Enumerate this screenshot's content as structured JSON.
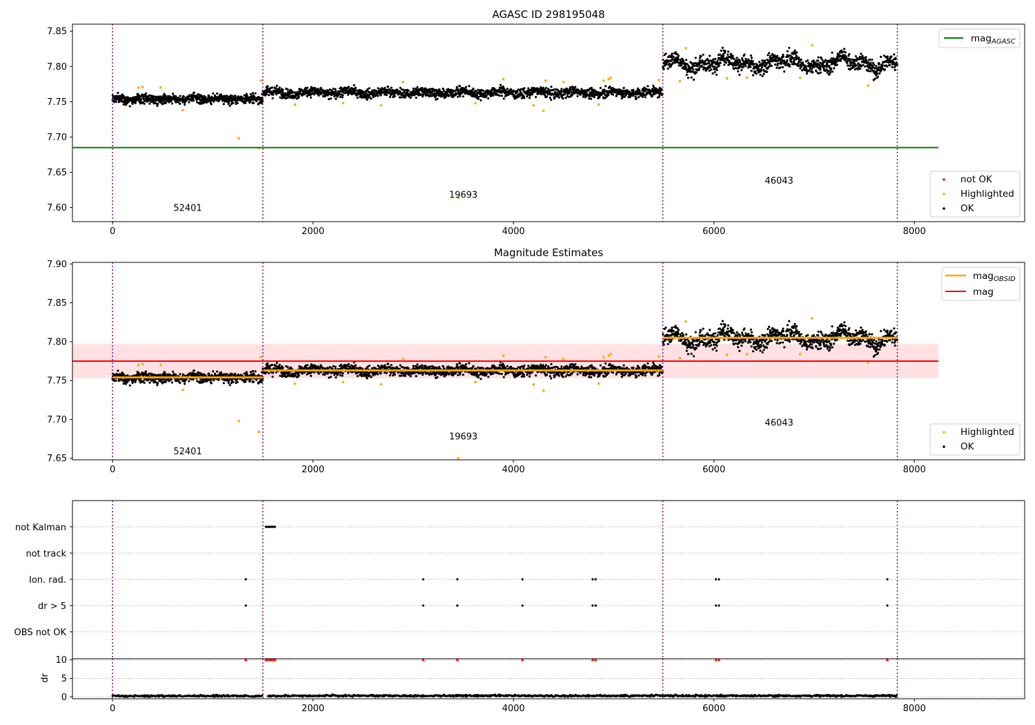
{
  "chart_data": [
    {
      "id": "panel1",
      "type": "scatter",
      "title": "AGASC ID 298195048",
      "xlim": [
        -400,
        9100
      ],
      "ylim": [
        7.58,
        7.86
      ],
      "xticks": [
        0,
        2000,
        4000,
        6000,
        8000
      ],
      "yticks": [
        7.6,
        7.65,
        7.7,
        7.75,
        7.8,
        7.85
      ],
      "ytick_labels": [
        "7.60",
        "7.65",
        "7.70",
        "7.75",
        "7.80",
        "7.85"
      ],
      "obs_boundaries": [
        0,
        1500,
        5490,
        7830
      ],
      "obs_labels": [
        {
          "text": "52401",
          "x": 750,
          "y": 7.595
        },
        {
          "text": "19693",
          "x": 3500,
          "y": 7.614
        },
        {
          "text": "46043",
          "x": 6650,
          "y": 7.634
        }
      ],
      "segments": [
        {
          "x0": 0,
          "x1": 1500,
          "level": 7.754,
          "sd": 0.0045,
          "n": 700
        },
        {
          "x0": 1500,
          "x1": 5490,
          "level": 7.763,
          "sd": 0.0048,
          "n": 1600
        },
        {
          "x0": 5490,
          "x1": 7830,
          "level": 7.805,
          "sd": 0.008,
          "n": 1000
        }
      ],
      "highlighted_points": [
        [
          260,
          7.77
        ],
        [
          300,
          7.771
        ],
        [
          480,
          7.77
        ],
        [
          700,
          7.738
        ],
        [
          1260,
          7.698
        ],
        [
          1460,
          7.684
        ],
        [
          1480,
          7.78
        ],
        [
          1820,
          7.746
        ],
        [
          2300,
          7.748
        ],
        [
          2680,
          7.745
        ],
        [
          2900,
          7.778
        ],
        [
          3450,
          7.614
        ],
        [
          3620,
          7.748
        ],
        [
          3900,
          7.782
        ],
        [
          4200,
          7.745
        ],
        [
          4300,
          7.737
        ],
        [
          4320,
          7.78
        ],
        [
          4500,
          7.778
        ],
        [
          4850,
          7.746
        ],
        [
          4900,
          7.78
        ],
        [
          4950,
          7.782
        ],
        [
          4970,
          7.784
        ],
        [
          5450,
          7.781
        ],
        [
          5660,
          7.779
        ],
        [
          5720,
          7.826
        ],
        [
          6130,
          7.783
        ],
        [
          6330,
          7.784
        ],
        [
          6860,
          7.784
        ],
        [
          6980,
          7.83
        ],
        [
          7540,
          7.773
        ]
      ],
      "reference_lines": [
        {
          "name": "mag_AGASC",
          "y": 7.685,
          "x0": -400,
          "x1": 8240,
          "color": "#008000"
        }
      ],
      "legend_top": [
        {
          "label": "mag",
          "sub": "AGASC",
          "color": "#008000",
          "kind": "line"
        }
      ],
      "legend_bottom": [
        {
          "label": "not OK",
          "color": "#ff0000",
          "kind": "dot"
        },
        {
          "label": "Highlighted",
          "color": "#ffa500",
          "kind": "dot"
        },
        {
          "label": "OK",
          "color": "#000000",
          "kind": "dot"
        }
      ]
    },
    {
      "id": "panel2",
      "type": "scatter",
      "title": "Magnitude Estimates",
      "xlim": [
        -400,
        9100
      ],
      "ylim": [
        7.648,
        7.902
      ],
      "xticks": [
        0,
        2000,
        4000,
        6000,
        8000
      ],
      "yticks": [
        7.65,
        7.7,
        7.75,
        7.8,
        7.85,
        7.9
      ],
      "ytick_labels": [
        "7.65",
        "7.70",
        "7.75",
        "7.80",
        "7.85",
        "7.90"
      ],
      "obs_boundaries": [
        0,
        1500,
        5490,
        7830
      ],
      "obs_labels": [
        {
          "text": "52401",
          "x": 750,
          "y": 7.655
        },
        {
          "text": "19693",
          "x": 3500,
          "y": 7.674
        },
        {
          "text": "46043",
          "x": 6650,
          "y": 7.692
        }
      ],
      "segments": [
        {
          "x0": 0,
          "x1": 1500,
          "level": 7.754,
          "sd": 0.0045,
          "n": 700
        },
        {
          "x0": 1500,
          "x1": 5490,
          "level": 7.763,
          "sd": 0.0048,
          "n": 1600
        },
        {
          "x0": 5490,
          "x1": 7830,
          "level": 7.805,
          "sd": 0.008,
          "n": 1000
        }
      ],
      "highlighted_points": [
        [
          260,
          7.77
        ],
        [
          300,
          7.771
        ],
        [
          480,
          7.77
        ],
        [
          700,
          7.738
        ],
        [
          1260,
          7.698
        ],
        [
          1460,
          7.684
        ],
        [
          1480,
          7.78
        ],
        [
          1820,
          7.746
        ],
        [
          2300,
          7.748
        ],
        [
          2680,
          7.745
        ],
        [
          2900,
          7.778
        ],
        [
          3450,
          7.65
        ],
        [
          3620,
          7.748
        ],
        [
          3900,
          7.782
        ],
        [
          4200,
          7.745
        ],
        [
          4300,
          7.737
        ],
        [
          4320,
          7.78
        ],
        [
          4500,
          7.778
        ],
        [
          4850,
          7.746
        ],
        [
          4900,
          7.78
        ],
        [
          4950,
          7.782
        ],
        [
          4970,
          7.784
        ],
        [
          5450,
          7.781
        ],
        [
          5660,
          7.779
        ],
        [
          5720,
          7.826
        ],
        [
          6130,
          7.783
        ],
        [
          6330,
          7.784
        ],
        [
          6860,
          7.784
        ],
        [
          6980,
          7.83
        ],
        [
          7540,
          7.773
        ]
      ],
      "obsid_means": [
        {
          "x0": 0,
          "x1": 1500,
          "y": 7.754
        },
        {
          "x0": 1500,
          "x1": 5490,
          "y": 7.763
        },
        {
          "x0": 5490,
          "x1": 7830,
          "y": 7.805
        }
      ],
      "reference_lines": [
        {
          "name": "mag",
          "y": 7.775,
          "x0": -400,
          "x1": 8240,
          "color": "#ff0000"
        }
      ],
      "band": {
        "y0": 7.753,
        "y1": 7.797,
        "x0": -400,
        "x1": 8240,
        "color": "#ffe0e3"
      },
      "legend_top": [
        {
          "label": "mag",
          "sub": "OBSID",
          "color": "#ffa500",
          "kind": "line"
        },
        {
          "label": "mag",
          "sub": "",
          "color": "#ff0000",
          "kind": "line"
        }
      ],
      "legend_bottom": [
        {
          "label": "Highlighted",
          "color": "#ffa500",
          "kind": "dot"
        },
        {
          "label": "OK",
          "color": "#000000",
          "kind": "dot"
        }
      ]
    },
    {
      "id": "panel3",
      "type": "scatter",
      "title": "",
      "xlim": [
        -400,
        9100
      ],
      "categories": [
        "not Kalman",
        "not track",
        "Ion. rad.",
        "dr > 5",
        "OBS not OK"
      ],
      "obs_boundaries": [
        0,
        1500,
        5490,
        7830
      ],
      "flag_points": {
        "not Kalman": [
          1530,
          1540,
          1550,
          1560,
          1570,
          1580,
          1590,
          1600,
          1610,
          1620
        ],
        "not track": [],
        "Ion. rad.": [
          1330,
          3100,
          3440,
          4090,
          4790,
          4820,
          6020,
          6050,
          7730
        ],
        "dr > 5": [
          1330,
          3100,
          3440,
          4090,
          4790,
          4820,
          6020,
          6050,
          7730
        ],
        "OBS not OK": []
      }
    },
    {
      "id": "panel4",
      "type": "scatter",
      "title": "",
      "ylabel": "dr",
      "xlim": [
        -400,
        9100
      ],
      "ylim": [
        -0.5,
        10.3
      ],
      "xticks": [
        0,
        2000,
        4000,
        6000,
        8000
      ],
      "yticks": [
        0,
        5,
        10
      ],
      "ytick_labels": [
        "0",
        "5",
        "10"
      ],
      "obs_boundaries": [
        0,
        1500,
        5490,
        7830
      ],
      "dr_segments": [
        {
          "x0": 0,
          "x1": 1500,
          "level": 0.25
        },
        {
          "x0": 1550,
          "x1": 5490,
          "level": 0.3
        },
        {
          "x0": 5490,
          "x1": 7830,
          "level": 0.3
        }
      ],
      "outlier_triangles": [
        [
          1330,
          10
        ],
        [
          1530,
          10
        ],
        [
          1550,
          10
        ],
        [
          1570,
          10
        ],
        [
          1590,
          10
        ],
        [
          1610,
          10
        ],
        [
          1620,
          10
        ],
        [
          3100,
          10
        ],
        [
          3440,
          10
        ],
        [
          4090,
          10
        ],
        [
          4790,
          10
        ],
        [
          4820,
          10
        ],
        [
          6020,
          10
        ],
        [
          6050,
          10
        ],
        [
          7730,
          10
        ]
      ]
    }
  ]
}
